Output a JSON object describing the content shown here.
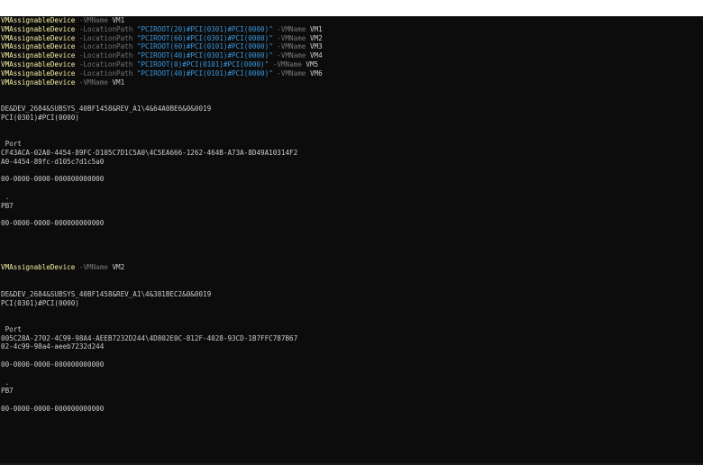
{
  "terminal": {
    "commands": [
      {
        "cmd": "VMAssignableDevice",
        "p1": "-VMName",
        "vm": "VM1"
      },
      {
        "cmd": "VMAssignableDevice",
        "p1": "-LocationPath",
        "path": "\"PCIROOT(20)#PCI(0301)#PCI(0000)\"",
        "p2": "-VMName",
        "vm": "VM1"
      },
      {
        "cmd": "VMAssignableDevice",
        "p1": "-LocationPath",
        "path": "\"PCIROOT(60)#PCI(0301)#PCI(0000)\"",
        "p2": "-VMName",
        "vm": "VM2"
      },
      {
        "cmd": "VMAssignableDevice",
        "p1": "-LocationPath",
        "path": "\"PCIROOT(60)#PCI(0101)#PCI(0000)\"",
        "p2": "-VMName",
        "vm": "VM3"
      },
      {
        "cmd": "VMAssignableDevice",
        "p1": "-LocationPath",
        "path": "\"PCIROOT(40)#PCI(0301)#PCI(0000)\"",
        "p2": "-VMName",
        "vm": "VM4"
      },
      {
        "cmd": "VMAssignableDevice",
        "p1": "-LocationPath",
        "path": "\"PCIROOT(0)#PCI(0101)#PCI(0000)\"",
        "p2": "-VMName",
        "vm": "VM5"
      },
      {
        "cmd": "VMAssignableDevice",
        "p1": "-LocationPath",
        "path": "\"PCIROOT(40)#PCI(0101)#PCI(0000)\"",
        "p2": "-VMName",
        "vm": "VM6"
      },
      {
        "cmd": "VMAssignableDevice",
        "p1": "-VMName",
        "vm": "VM1"
      }
    ],
    "block1": {
      "instance_id": "DE&DEV_2684&SUBSYS_40BF1458&REV_A1\\4&64A0BE6&0&0019",
      "location_path": "PCI(0301)#PCI(0000)",
      "port_label": " Port",
      "vmbus_path": "CF43ACA-02A0-4454-89FC-D105C7D1C5A0\\4C5EA666-1262-464B-A73A-8D49A10314F2",
      "device_guid": "A0-4454-89fc-d105c7d1c5a0",
      "guid1": "00-0000-0000-000000000000",
      "dot": " .",
      "pb7": "PB7",
      "guid2": "00-0000-0000-000000000000"
    },
    "command2": {
      "cmd": "VMAssignableDevice",
      "p1": "-VMName",
      "vm": "VM2"
    },
    "block2": {
      "instance_id": "DE&DEV_2684&SUBSYS_40BF1458&REV_A1\\4&381BEC2&0&0019",
      "location_path": "PCI(0301)#PCI(0000)",
      "port_label": " Port",
      "vmbus_path": "005C28A-2702-4C99-98A4-AEEB7232D244\\4D802E0C-812F-4028-93CD-1B7FFC787B67",
      "device_guid": "02-4c99-98a4-aeeb7232d244",
      "guid1": "00-0000-0000-000000000000",
      "dot": " .",
      "pb7": "PB7",
      "guid2": "00-0000-0000-000000000000"
    }
  }
}
